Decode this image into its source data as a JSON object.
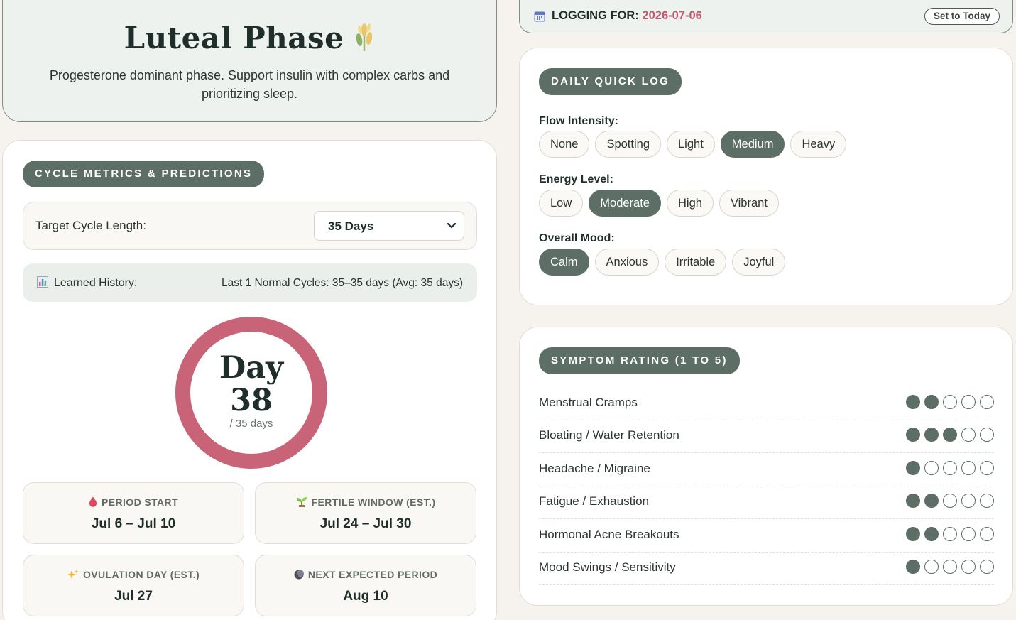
{
  "phase": {
    "title": "Luteal Phase",
    "description": "Progesterone dominant phase. Support insulin with complex carbs and prioritizing sleep.",
    "icon": "wheat-icon"
  },
  "metrics": {
    "header": "CYCLE METRICS & PREDICTIONS",
    "target_label": "Target Cycle Length:",
    "target_value": "35 Days",
    "history_label": "Learned History:",
    "history_value": "Last 1 Normal Cycles: 35–35 days (Avg: 35 days)",
    "day_text": "Day",
    "day_number": "38",
    "day_sub": "/ 35 days",
    "ring_color": "#c96478",
    "stats": [
      {
        "label": "PERIOD START",
        "value": "Jul 6 – Jul 10",
        "icon": "blood-drop-icon"
      },
      {
        "label": "FERTILE WINDOW (EST.)",
        "value": "Jul 24 – Jul 30",
        "icon": "seedling-icon"
      },
      {
        "label": "OVULATION DAY (EST.)",
        "value": "Jul 27",
        "icon": "sparkles-icon"
      },
      {
        "label": "NEXT EXPECTED PERIOD",
        "value": "Aug 10",
        "icon": "moon-icon"
      }
    ]
  },
  "logging": {
    "label": "LOGGING FOR:",
    "date": "2026-07-06",
    "button": "Set to Today"
  },
  "quick_log": {
    "header": "DAILY QUICK LOG",
    "flow": {
      "label": "Flow Intensity:",
      "options": [
        "None",
        "Spotting",
        "Light",
        "Medium",
        "Heavy"
      ],
      "selected": "Medium"
    },
    "energy": {
      "label": "Energy Level:",
      "options": [
        "Low",
        "Moderate",
        "High",
        "Vibrant"
      ],
      "selected": "Moderate"
    },
    "mood": {
      "label": "Overall Mood:",
      "options": [
        "Calm",
        "Anxious",
        "Irritable",
        "Joyful"
      ],
      "selected": "Calm"
    }
  },
  "symptoms": {
    "header": "SYMPTOM RATING (1 TO 5)",
    "items": [
      {
        "name": "Menstrual Cramps",
        "rating": 2
      },
      {
        "name": "Bloating / Water Retention",
        "rating": 3
      },
      {
        "name": "Headache / Migraine",
        "rating": 1
      },
      {
        "name": "Fatigue / Exhaustion",
        "rating": 2
      },
      {
        "name": "Hormonal Acne Breakouts",
        "rating": 2
      },
      {
        "name": "Mood Swings / Sensitivity",
        "rating": 1
      }
    ]
  },
  "colors": {
    "accent": "#5c6e66",
    "rose": "#c96478",
    "background": "#f6f3ee"
  }
}
